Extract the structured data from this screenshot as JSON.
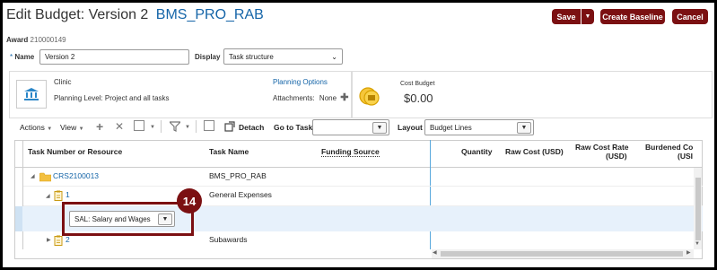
{
  "header": {
    "title_prefix": "Edit Budget: Version 2",
    "title_link": "BMS_PRO_RAB",
    "save_label": "Save",
    "save_menu_arrow": "▼",
    "create_baseline_label": "Create Baseline",
    "cancel_label": "Cancel"
  },
  "award": {
    "label": "Award",
    "value": "210000149"
  },
  "form": {
    "name_required": "*",
    "name_label": "Name",
    "name_value": "Version 2",
    "display_label": "Display",
    "display_value": "Task structure"
  },
  "summary": {
    "org_name": "Clinic",
    "planning_level": "Planning Level: Project and all tasks",
    "planning_options": "Planning Options",
    "attachments_label": "Attachments:",
    "attachments_value": "None",
    "cost_budget_label": "Cost Budget",
    "cost_budget_value": "$0.00"
  },
  "toolbar": {
    "actions": "Actions",
    "view": "View",
    "detach": "Detach",
    "go_to_task": "Go to Task",
    "go_to_task_value": "",
    "layout_label": "Layout",
    "layout_value": "Budget Lines"
  },
  "table": {
    "headers": {
      "task": "Task Number or Resource",
      "task_name": "Task Name",
      "funding": "Funding Source",
      "quantity": "Quantity",
      "raw_cost": "Raw Cost (USD)",
      "raw_rate_1": "Raw Cost Rate",
      "raw_rate_2": "(USD)",
      "burdened_1": "Burdened Co",
      "burdened_2": "(USI"
    },
    "rows": [
      {
        "number": "CRS2100013",
        "name": "BMS_PRO_RAB"
      },
      {
        "number": "1",
        "name": "General Expenses"
      },
      {
        "resource": "SAL: Salary and Wages"
      },
      {
        "number": "2",
        "name": "Subawards"
      }
    ]
  },
  "callout": {
    "step": "14"
  },
  "colors": {
    "brand_red": "#7b1012",
    "link_blue": "#1565a8",
    "selected_row": "#e7f1fb",
    "gold": "#f0b400"
  }
}
